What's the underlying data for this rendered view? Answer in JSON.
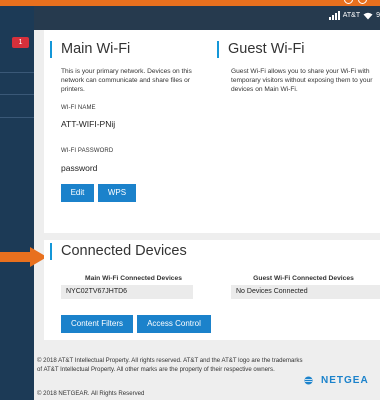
{
  "statusbar": {
    "carrier": "AT&T",
    "battery": "9"
  },
  "badge": {
    "count": "1"
  },
  "main_wifi": {
    "title": "Main Wi-Fi",
    "description": "This is your primary network. Devices on this network can communicate and share files or printers.",
    "name_label": "WI-FI NAME",
    "name_value": "ATT-WIFI-PNij",
    "password_label": "WI-FI PASSWORD",
    "password_value": "password",
    "edit_label": "Edit",
    "wps_label": "WPS"
  },
  "guest_wifi": {
    "title": "Guest Wi-Fi",
    "description": "Guest Wi-Fi allows you to share your Wi-Fi with temporary visitors without exposing them to your devices on Main Wi-Fi."
  },
  "connected": {
    "title": "Connected Devices",
    "main_header": "Main Wi-Fi Connected Devices",
    "main_device": "NYC02TV67JHTD6",
    "guest_header": "Guest Wi-Fi Connected Devices",
    "guest_device": "No Devices Connected",
    "content_filters_label": "Content Filters",
    "access_control_label": "Access Control"
  },
  "footer": {
    "copyright_att": "© 2018 AT&T Intellectual Property. All rights reserved. AT&T and the AT&T logo are the trademarks of AT&T Intellectual Property. All other marks are the property of their respective owners.",
    "copyright_netgear": "© 2018 NETGEAR. All Rights Reserved",
    "brand": "NETGEA"
  },
  "colors": {
    "accent": "#1b82cb",
    "callout": "#e8701e",
    "sidebar": "#1c3a56",
    "statusbar": "#263a4e",
    "badge": "#d6303b"
  }
}
